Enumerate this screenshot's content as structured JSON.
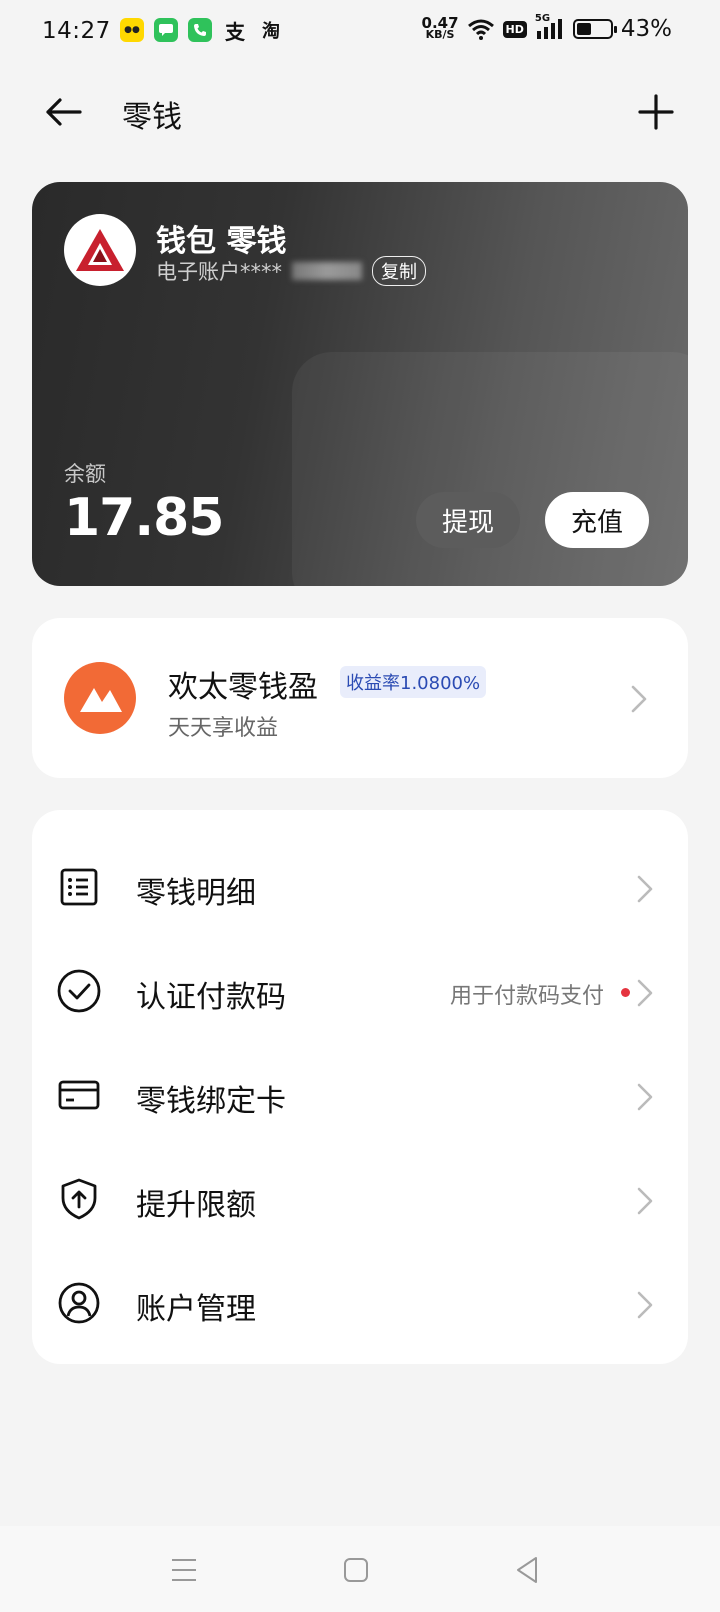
{
  "status_bar": {
    "time": "14:27",
    "net_speed": "0.47",
    "net_unit": "KB/S",
    "hd": "HD",
    "signal": "5G",
    "battery_pct": "43%",
    "battery_level": 0.43,
    "apps": [
      "meituan-icon",
      "message-icon",
      "phone-icon",
      "alipay-icon",
      "taobao-icon"
    ]
  },
  "header": {
    "title": "零钱"
  },
  "wallet": {
    "title": "钱包 零钱",
    "account_prefix": "电子账户****",
    "copy_label": "复制",
    "balance_label": "余额",
    "balance": "17.85",
    "withdraw_label": "提现",
    "topup_label": "充值",
    "logo_color": "#c8202e"
  },
  "fund": {
    "name": "欢太零钱盈",
    "rate_badge": "收益率1.0800%",
    "subtitle": "天天享收益",
    "logo_color": "#f26a36"
  },
  "menu": {
    "items": [
      {
        "label": "零钱明细",
        "icon": "list-icon",
        "hint": ""
      },
      {
        "label": "认证付款码",
        "icon": "check-circle-icon",
        "hint": "用于付款码支付"
      },
      {
        "label": "零钱绑定卡",
        "icon": "card-icon",
        "hint": ""
      },
      {
        "label": "提升限额",
        "icon": "shield-up-icon",
        "hint": ""
      },
      {
        "label": "账户管理",
        "icon": "user-circle-icon",
        "hint": ""
      }
    ]
  },
  "colors": {
    "accent_red": "#e5343f",
    "rate_text": "#2b4bb3"
  }
}
